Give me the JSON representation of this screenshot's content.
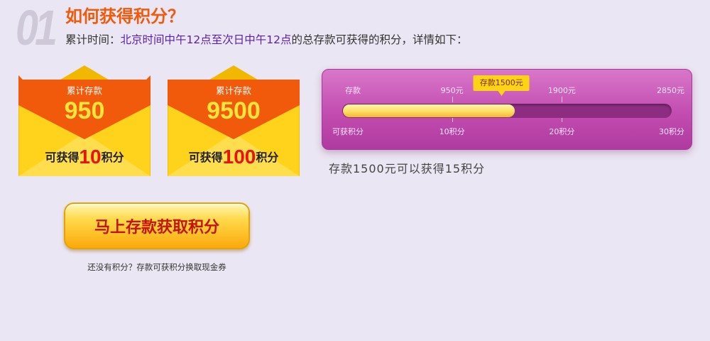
{
  "header": {
    "step": "01",
    "title": "如何获得积分？",
    "subtitle_prefix": "累计时间：",
    "subtitle_highlight": "北京时间中午12点至次日中午12点",
    "subtitle_suffix": "的总存款可获得的积分，详情如下："
  },
  "envelopes": [
    {
      "label": "累计存款",
      "amount": "950",
      "earn_prefix": "可获得",
      "points": "10",
      "earn_suffix": "积分"
    },
    {
      "label": "累计存款",
      "amount": "9500",
      "earn_prefix": "可获得",
      "points": "100",
      "earn_suffix": "积分"
    }
  ],
  "cta": {
    "label": "马上存款获取积分"
  },
  "note": "还没有积分？存款可获积分换取现金券",
  "progress": {
    "deposit_label": "存款",
    "points_label": "可获积分",
    "ticks": [
      {
        "deposit": "950元",
        "points": "10积分"
      },
      {
        "deposit": "1900元",
        "points": "20积分"
      },
      {
        "deposit": "2850元",
        "points": "30积分"
      }
    ],
    "max_deposit": 2850,
    "current_deposit": 1500,
    "marker": "存款1500元",
    "status": "存款1500元可以获得15积分"
  },
  "colors": {
    "accent": "#f15a0a",
    "highlight": "#5a1fa8",
    "panel": "#c24cb0",
    "envelope": "#ffd21c",
    "envelope_flap": "#f15a0a",
    "points": "#e8140a"
  }
}
